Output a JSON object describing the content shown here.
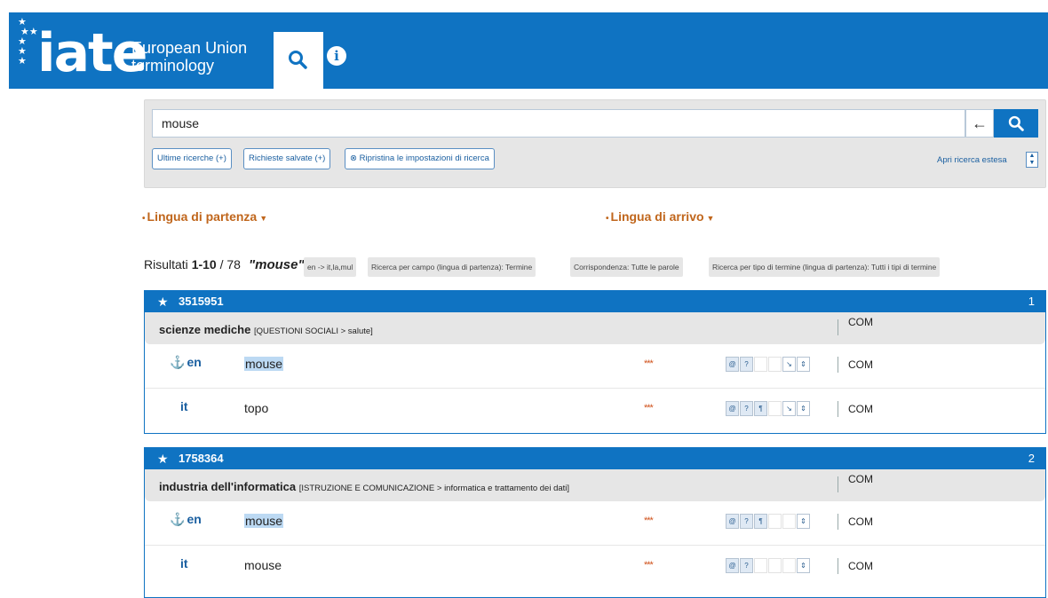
{
  "header": {
    "logo_text": "iate",
    "logo_sub_line1": "European Union",
    "logo_sub_line2": "terminology",
    "tab_search_icon": "search-icon",
    "tab_info_icon": "info-icon",
    "brand_color": "#0f73c2"
  },
  "search": {
    "query": "mouse",
    "recent_label": "Ultime ricerche (+)",
    "saved_label": "Richieste salvate (+)",
    "reset_label": "Ripristina le impostazioni di ricerca",
    "advanced_label": "Apri ricerca estesa"
  },
  "languages": {
    "source_label": "Lingua di partenza",
    "target_label": "Lingua di arrivo"
  },
  "results": {
    "count_prefix": "Risultati ",
    "count_range": "1-10",
    "count_total": " / 78",
    "query_display": "\"mouse\"",
    "chips": [
      "en -> it,la,mul",
      "Ricerca per campo (lingua di partenza): Termine",
      "Corrispondenza: Tutte le parole",
      "Ricerca per tipo di termine (lingua di partenza): Tutti i tipi di termine"
    ]
  },
  "entries": [
    {
      "id": "3515951",
      "number": "1",
      "domain": "scienze mediche",
      "domain_path": "[QUESTIONI SOCIALI > salute]",
      "domain_institution": "COM",
      "terms": [
        {
          "lang": "en",
          "term": "mouse",
          "highlighted": true,
          "reliability": "***",
          "institution": "COM"
        },
        {
          "lang": "it",
          "term": "topo",
          "highlighted": false,
          "reliability": "***",
          "institution": "COM"
        }
      ]
    },
    {
      "id": "1758364",
      "number": "2",
      "domain": "industria dell'informatica",
      "domain_path": "[ISTRUZIONE E COMUNICAZIONE > informatica e trattamento dei dati]",
      "domain_institution": "COM",
      "terms": [
        {
          "lang": "en",
          "term": "mouse",
          "highlighted": true,
          "reliability": "***",
          "institution": "COM"
        },
        {
          "lang": "it",
          "term": "mouse",
          "highlighted": false,
          "reliability": "***",
          "institution": "COM"
        }
      ]
    }
  ]
}
